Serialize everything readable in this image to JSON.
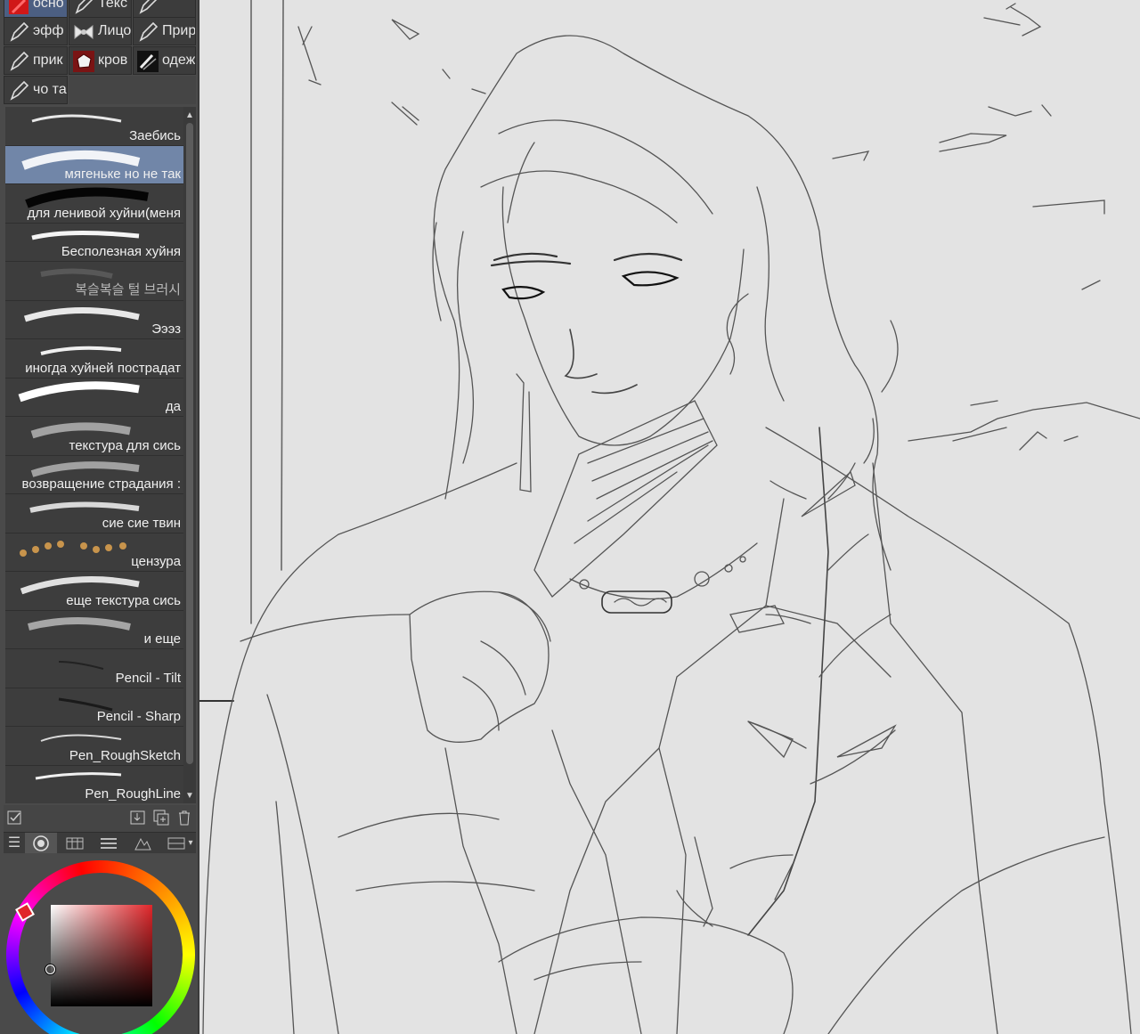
{
  "tool_tabs": [
    {
      "label": "осно",
      "icon": "red-brush-icon"
    },
    {
      "label": "Текс",
      "icon": "pen-icon"
    },
    {
      "label": "",
      "icon": "pen-icon"
    },
    {
      "label": "эфф",
      "icon": "pen-icon"
    },
    {
      "label": "Лицо",
      "icon": "bow-icon"
    },
    {
      "label": "Прир",
      "icon": "pen-icon"
    },
    {
      "label": "прик",
      "icon": "pen-icon"
    },
    {
      "label": "кров",
      "icon": "blood-drop-icon"
    },
    {
      "label": "одеж",
      "icon": "clothing-brush-icon"
    },
    {
      "label": "чо та",
      "icon": "pen-icon"
    }
  ],
  "brushes": [
    {
      "label": "Заебись"
    },
    {
      "label": "мягеньке но не так",
      "selected": true
    },
    {
      "label": "для ленивой хуйни(меня"
    },
    {
      "label": "Бесполезная хуйня"
    },
    {
      "label": "복슬복슬 털 브러시"
    },
    {
      "label": "Эээз"
    },
    {
      "label": "иногда хуйней пострадат"
    },
    {
      "label": "да"
    },
    {
      "label": "текстура для сись"
    },
    {
      "label": "возвращение страдания :"
    },
    {
      "label": "сие сие твин"
    },
    {
      "label": "цензура"
    },
    {
      "label": "еще текстура сись"
    },
    {
      "label": "и еще"
    },
    {
      "label": "Pencil - Tilt"
    },
    {
      "label": "Pencil - Sharp"
    },
    {
      "label": "Pen_RoughSketch"
    },
    {
      "label": "Pen_RoughLine"
    }
  ],
  "colors": {
    "panel_bg": "#4a4a4a",
    "selected_brush": "#7186a8",
    "active_tab": "#4c5f82",
    "canvas_bg": "#e3e3e3",
    "current_color": "#e0262a"
  }
}
